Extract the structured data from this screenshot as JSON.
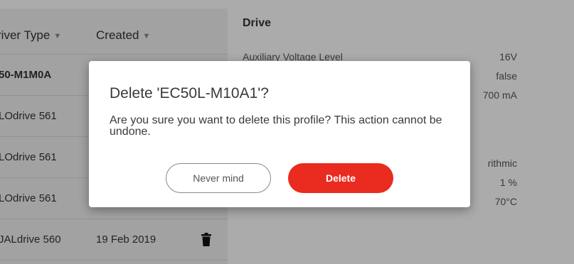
{
  "list": {
    "columns": [
      {
        "label": "river Type"
      },
      {
        "label": "Created"
      }
    ],
    "rows": [
      {
        "type": "50-M1M0A",
        "created": ""
      },
      {
        "type": "LOdrive 561",
        "created": ""
      },
      {
        "type": "LOdrive 561",
        "created": ""
      },
      {
        "type": "LOdrive 561",
        "created": ""
      },
      {
        "type": "JALdrive 560",
        "created": "19 Feb 2019"
      }
    ]
  },
  "detail": {
    "title": "Drive",
    "props": [
      {
        "label": "Auxiliary Voltage Level",
        "value": "16V"
      },
      {
        "label": "",
        "value": "false"
      },
      {
        "label": "",
        "value": "700 mA"
      },
      {
        "label": "",
        "value": "rithmic"
      },
      {
        "label": "",
        "value": "1 %"
      },
      {
        "label": "",
        "value": "70°C"
      }
    ]
  },
  "modal": {
    "title": "Delete 'EC50L-M10A1'?",
    "message": "Are you sure you want to delete this profile? This action cannot be undone.",
    "cancel_label": "Never mind",
    "confirm_label": "Delete"
  },
  "colors": {
    "danger": "#ea2b1f",
    "overlay": "rgba(0,0,0,0.33)"
  },
  "icons": {
    "sort": "caret-down-icon",
    "row_action": "trash-icon"
  }
}
